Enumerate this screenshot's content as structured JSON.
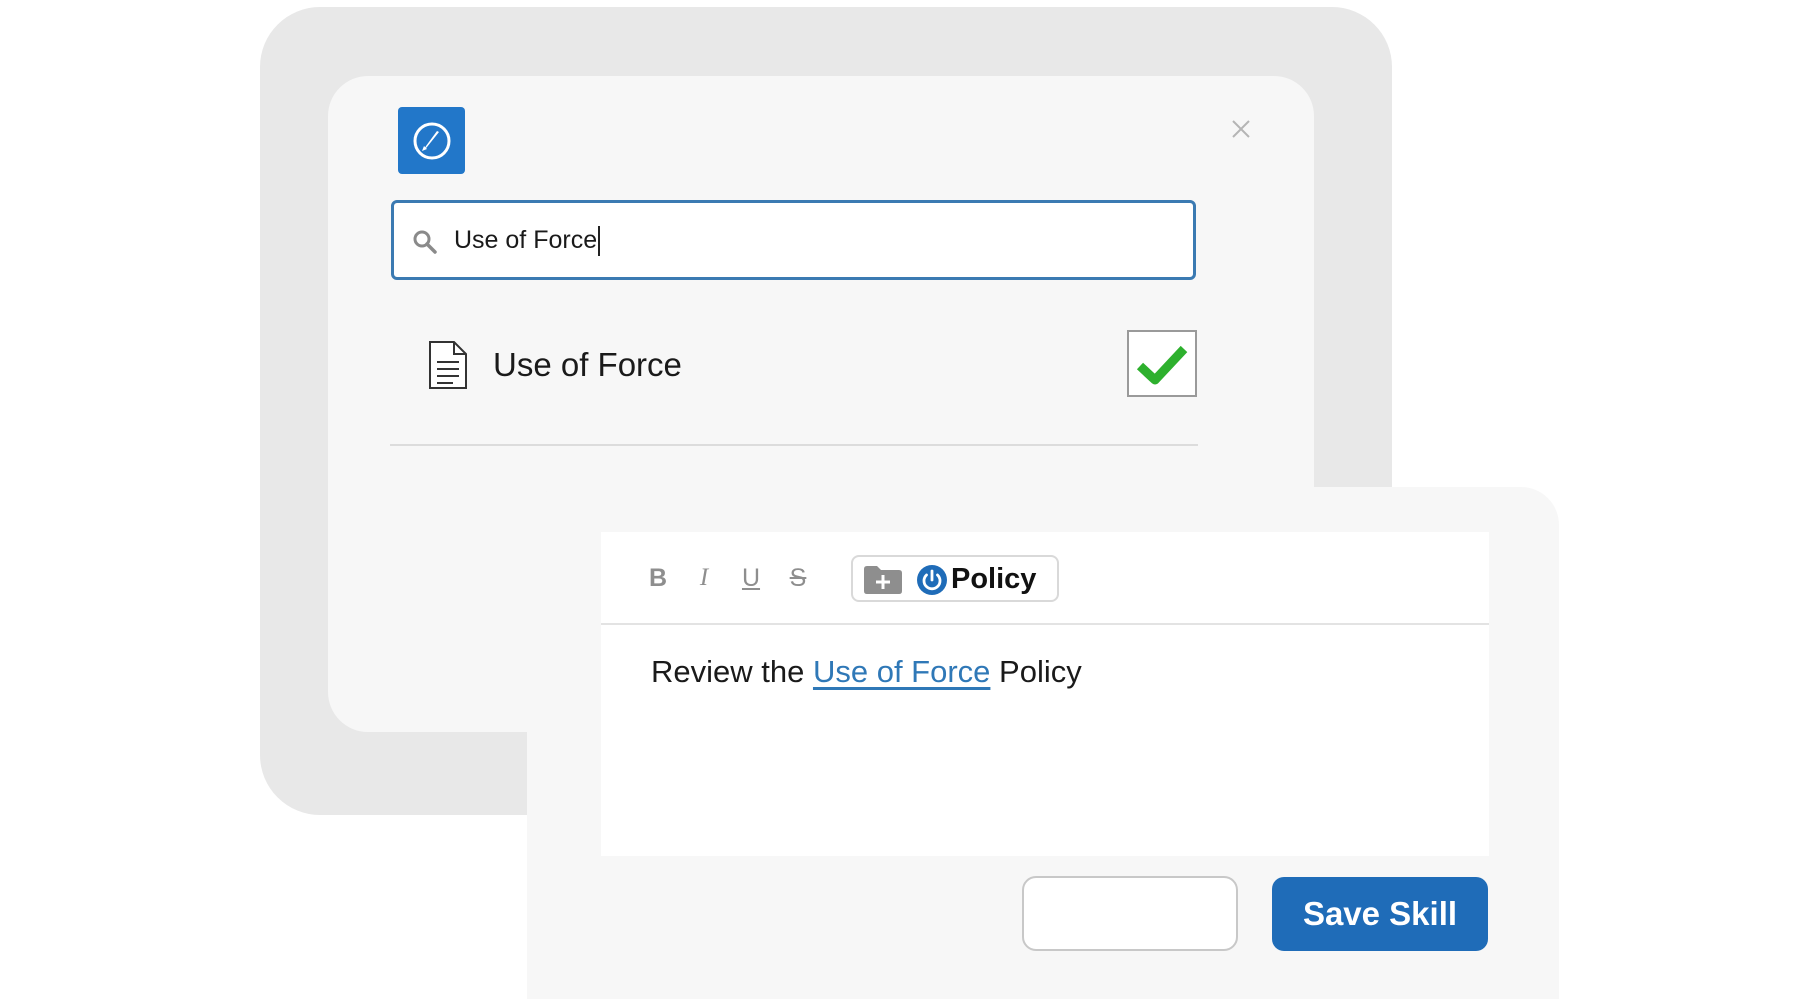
{
  "colors": {
    "accent": "#2277c9",
    "search_border": "#3b7ab2",
    "check_green": "#2db02d",
    "link": "#2f78b7",
    "primary_button": "#1f6cb8"
  },
  "search_panel": {
    "app_icon": "compass-edit-icon",
    "close_icon": "close-icon",
    "search": {
      "icon": "search-icon",
      "value": "Use of Force"
    },
    "result": {
      "icon": "document-icon",
      "label": "Use of Force",
      "checked": true
    }
  },
  "editor_panel": {
    "toolbar": {
      "bold": "B",
      "italic": "I",
      "underline": "U",
      "strike": "S",
      "policy_button": {
        "icons": [
          "folder-plus-icon",
          "power-icon"
        ],
        "label": "Policy"
      }
    },
    "body": {
      "prefix": "Review the ",
      "link": "Use of Force",
      "suffix": " Policy"
    },
    "buttons": {
      "cancel_label": "",
      "save_label": "Save Skill"
    }
  }
}
